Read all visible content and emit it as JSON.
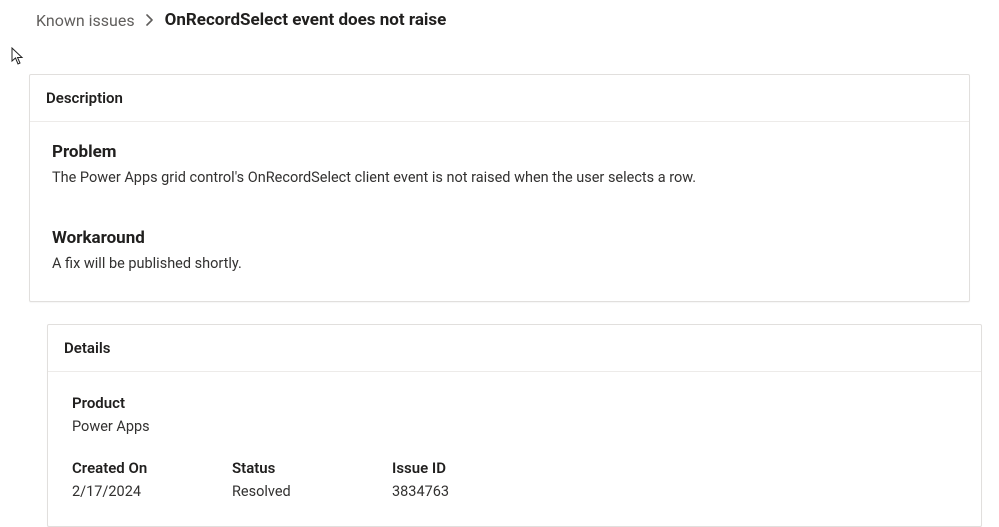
{
  "breadcrumb": {
    "parent": "Known issues",
    "current": "OnRecordSelect event does not raise"
  },
  "description": {
    "header": "Description",
    "problem_heading": "Problem",
    "problem_text": "The Power Apps grid control's OnRecordSelect client event is not raised when the user selects a row.",
    "workaround_heading": "Workaround",
    "workaround_text": "A fix will be published shortly."
  },
  "details": {
    "header": "Details",
    "product_label": "Product",
    "product_value": "Power Apps",
    "created_label": "Created On",
    "created_value": "2/17/2024",
    "status_label": "Status",
    "status_value": "Resolved",
    "issueid_label": "Issue ID",
    "issueid_value": "3834763"
  }
}
